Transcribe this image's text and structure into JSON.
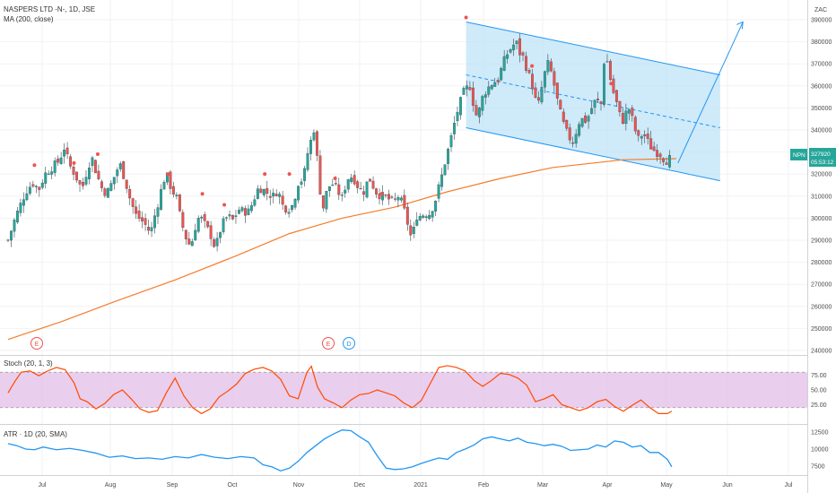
{
  "header": {
    "symbol_line": "NASPERS LTD -N-, 1D, JSE",
    "ma_line": "MA (200, close)",
    "zac_label": "ZAC"
  },
  "price_badge": {
    "ticker": "NPN",
    "price": "327920",
    "countdown": "05:53:12",
    "color": "#26a69a"
  },
  "colors": {
    "up": "#26a69a",
    "down": "#ef5350",
    "ma": "#f57c2b",
    "channel_fill": "#bfe3f7",
    "channel_line": "#2196f3",
    "stoch_band": "#e1bee7",
    "stoch_line": "#ff4a00",
    "atr_line": "#2196f3"
  },
  "events": [
    {
      "label": "E",
      "type": "earnings",
      "date": "2020-06-22"
    },
    {
      "label": "E",
      "type": "earnings",
      "date": "2020-11-23"
    },
    {
      "label": "D",
      "type": "dividend",
      "date": "2020-12-04"
    }
  ],
  "chart_data": [
    {
      "type": "candlestick",
      "title": "NASPERS LTD -N-, 1D, JSE",
      "x_ticks": [
        "Jul",
        "Aug",
        "Sep",
        "Oct",
        "Nov",
        "Dec",
        "2021",
        "Feb",
        "Mar",
        "Apr",
        "May",
        "Jun",
        "Jul"
      ],
      "y_ticks": [
        240000,
        250000,
        260000,
        270000,
        280000,
        290000,
        300000,
        310000,
        320000,
        330000,
        340000,
        350000,
        360000,
        370000,
        380000,
        390000
      ],
      "ylim": [
        236000,
        392000
      ],
      "last_price": 327920,
      "close_path": [
        [
          0,
          290000
        ],
        [
          8,
          300000
        ],
        [
          14,
          306000
        ],
        [
          20,
          312000
        ],
        [
          28,
          316000
        ],
        [
          35,
          313000
        ],
        [
          42,
          320000
        ],
        [
          50,
          323000
        ],
        [
          58,
          326000
        ],
        [
          64,
          332000
        ],
        [
          70,
          324000
        ],
        [
          76,
          320000
        ],
        [
          84,
          313000
        ],
        [
          90,
          322000
        ],
        [
          95,
          328000
        ],
        [
          100,
          321000
        ],
        [
          106,
          314000
        ],
        [
          112,
          311000
        ],
        [
          118,
          316000
        ],
        [
          124,
          322000
        ],
        [
          128,
          324000
        ],
        [
          134,
          316000
        ],
        [
          140,
          307000
        ],
        [
          146,
          301000
        ],
        [
          152,
          299000
        ],
        [
          158,
          296000
        ],
        [
          162,
          293000
        ],
        [
          168,
          303000
        ],
        [
          172,
          309000
        ],
        [
          176,
          316000
        ],
        [
          180,
          320000
        ],
        [
          186,
          313000
        ],
        [
          192,
          309000
        ],
        [
          196,
          300000
        ],
        [
          200,
          294000
        ],
        [
          205,
          288000
        ],
        [
          210,
          290000
        ],
        [
          214,
          298000
        ],
        [
          218,
          301000
        ],
        [
          224,
          297000
        ],
        [
          230,
          293000
        ],
        [
          236,
          286000
        ],
        [
          240,
          293000
        ],
        [
          245,
          298000
        ],
        [
          250,
          301000
        ],
        [
          256,
          299000
        ],
        [
          262,
          304000
        ],
        [
          268,
          303000
        ],
        [
          274,
          303000
        ],
        [
          280,
          309000
        ],
        [
          285,
          314000
        ],
        [
          290,
          313000
        ],
        [
          296,
          311000
        ],
        [
          302,
          310000
        ],
        [
          307,
          313000
        ],
        [
          312,
          306000
        ],
        [
          318,
          304000
        ],
        [
          324,
          306000
        ],
        [
          330,
          316000
        ],
        [
          336,
          318000
        ],
        [
          341,
          330000
        ],
        [
          345,
          336000
        ],
        [
          349,
          342000
        ],
        [
          353,
          318000
        ],
        [
          358,
          304000
        ],
        [
          363,
          313000
        ],
        [
          368,
          316000
        ],
        [
          374,
          313000
        ],
        [
          380,
          309000
        ],
        [
          386,
          318000
        ],
        [
          392,
          319000
        ],
        [
          396,
          316000
        ],
        [
          400,
          313000
        ],
        [
          406,
          312000
        ],
        [
          410,
          319000
        ],
        [
          416,
          314000
        ],
        [
          420,
          311000
        ],
        [
          426,
          310000
        ],
        [
          432,
          309000
        ],
        [
          438,
          307000
        ],
        [
          444,
          310000
        ],
        [
          449,
          306000
        ],
        [
          453,
          300000
        ],
        [
          458,
          292000
        ],
        [
          462,
          295000
        ],
        [
          466,
          303000
        ],
        [
          470,
          300000
        ],
        [
          474,
          303000
        ],
        [
          478,
          301000
        ],
        [
          482,
          304000
        ],
        [
          486,
          308000
        ],
        [
          490,
          314000
        ],
        [
          494,
          320000
        ],
        [
          498,
          327000
        ],
        [
          502,
          333000
        ],
        [
          506,
          340000
        ],
        [
          510,
          347000
        ],
        [
          514,
          352000
        ],
        [
          518,
          357000
        ],
        [
          522,
          359000
        ],
        [
          526,
          360000
        ],
        [
          530,
          350000
        ],
        [
          534,
          345000
        ],
        [
          538,
          353000
        ],
        [
          542,
          357000
        ],
        [
          546,
          359000
        ],
        [
          550,
          361000
        ],
        [
          554,
          362000
        ],
        [
          558,
          363000
        ],
        [
          562,
          369000
        ],
        [
          566,
          373000
        ],
        [
          570,
          376000
        ],
        [
          574,
          378000
        ],
        [
          578,
          380000
        ],
        [
          582,
          375000
        ],
        [
          586,
          373000
        ],
        [
          590,
          368000
        ],
        [
          594,
          363000
        ],
        [
          598,
          358000
        ],
        [
          602,
          349000
        ],
        [
          606,
          357000
        ],
        [
          610,
          365000
        ],
        [
          614,
          370000
        ],
        [
          618,
          366000
        ],
        [
          622,
          359000
        ],
        [
          626,
          351000
        ],
        [
          630,
          345000
        ],
        [
          634,
          340000
        ],
        [
          638,
          337000
        ],
        [
          642,
          334000
        ],
        [
          646,
          339000
        ],
        [
          650,
          344000
        ],
        [
          654,
          345000
        ],
        [
          658,
          344000
        ],
        [
          662,
          348000
        ],
        [
          666,
          352000
        ],
        [
          670,
          354000
        ],
        [
          674,
          349000
        ],
        [
          678,
          371000
        ],
        [
          682,
          371000
        ],
        [
          686,
          361000
        ],
        [
          690,
          355000
        ],
        [
          694,
          350000
        ],
        [
          698,
          343000
        ],
        [
          702,
          347000
        ],
        [
          706,
          350000
        ],
        [
          710,
          345000
        ],
        [
          714,
          339000
        ],
        [
          718,
          335000
        ],
        [
          722,
          339000
        ],
        [
          726,
          336000
        ],
        [
          730,
          333000
        ],
        [
          734,
          331000
        ],
        [
          738,
          330000
        ],
        [
          742,
          329000
        ],
        [
          746,
          327000
        ],
        [
          750,
          326000
        ],
        [
          755,
          327920
        ]
      ],
      "ma200": [
        [
          0,
          245000
        ],
        [
          60,
          253000
        ],
        [
          120,
          262000
        ],
        [
          190,
          272000
        ],
        [
          260,
          283000
        ],
        [
          320,
          293000
        ],
        [
          380,
          300000
        ],
        [
          440,
          305000
        ],
        [
          500,
          312000
        ],
        [
          560,
          318000
        ],
        [
          620,
          323000
        ],
        [
          700,
          326500
        ],
        [
          760,
          327000
        ]
      ],
      "channel": {
        "upper": [
          [
            521,
            389000
          ],
          [
            810,
            365000
          ]
        ],
        "lower": [
          [
            521,
            341000
          ],
          [
            810,
            317000
          ]
        ],
        "mid": [
          [
            521,
            365000
          ],
          [
            810,
            341000
          ]
        ]
      },
      "projection_arrow": [
        [
          762,
          325000
        ],
        [
          836,
          389000
        ]
      ],
      "markers": [
        {
          "x": 30,
          "v": 322000
        },
        {
          "x": 75,
          "v": 323000
        },
        {
          "x": 102,
          "v": 327000
        },
        {
          "x": 182,
          "v": 318000
        },
        {
          "x": 221,
          "v": 309000
        },
        {
          "x": 246,
          "v": 304000
        },
        {
          "x": 292,
          "v": 318000
        },
        {
          "x": 320,
          "v": 318000
        },
        {
          "x": 372,
          "v": 316000
        },
        {
          "x": 425,
          "v": 309000
        },
        {
          "x": 521,
          "v": 389000
        },
        {
          "x": 596,
          "v": 367000
        },
        {
          "x": 686,
          "v": 359000
        }
      ]
    },
    {
      "type": "line",
      "title": "Stoch (20, 1, 3)",
      "y_ticks": [
        25.0,
        50.0,
        75.0
      ],
      "ylim": [
        0,
        100
      ],
      "band": [
        20,
        80
      ],
      "x": [
        0,
        8,
        15,
        25,
        35,
        45,
        55,
        65,
        75,
        82,
        90,
        100,
        110,
        120,
        130,
        140,
        150,
        160,
        170,
        180,
        190,
        200,
        210,
        220,
        230,
        240,
        250,
        260,
        270,
        280,
        290,
        300,
        310,
        320,
        330,
        340,
        345,
        352,
        360,
        370,
        380,
        390,
        400,
        410,
        420,
        430,
        440,
        450,
        460,
        470,
        480,
        490,
        500,
        510,
        520,
        530,
        540,
        550,
        560,
        570,
        580,
        590,
        600,
        610,
        620,
        630,
        640,
        650,
        660,
        670,
        680,
        690,
        700,
        710,
        720,
        730,
        740,
        750,
        755
      ],
      "y": [
        45,
        65,
        80,
        82,
        74,
        82,
        88,
        84,
        62,
        35,
        30,
        18,
        27,
        42,
        50,
        35,
        18,
        12,
        15,
        45,
        70,
        40,
        20,
        10,
        18,
        38,
        48,
        60,
        78,
        85,
        88,
        82,
        68,
        40,
        35,
        80,
        90,
        55,
        35,
        28,
        20,
        33,
        42,
        44,
        50,
        45,
        40,
        28,
        20,
        32,
        60,
        88,
        91,
        88,
        82,
        66,
        56,
        66,
        78,
        76,
        70,
        58,
        30,
        35,
        42,
        25,
        20,
        15,
        20,
        30,
        34,
        22,
        14,
        24,
        33,
        20,
        10,
        10,
        14
      ]
    },
    {
      "type": "line",
      "title": "ATR · 1D (20, SMA)",
      "y_ticks": [
        7500,
        10000,
        12500
      ],
      "ylim": [
        6000,
        13000
      ],
      "x": [
        0,
        10,
        20,
        30,
        40,
        55,
        70,
        85,
        100,
        115,
        130,
        145,
        160,
        175,
        190,
        205,
        220,
        235,
        250,
        265,
        280,
        290,
        300,
        310,
        320,
        330,
        340,
        350,
        360,
        370,
        380,
        390,
        400,
        410,
        420,
        430,
        440,
        450,
        460,
        470,
        480,
        490,
        500,
        510,
        520,
        530,
        540,
        550,
        560,
        570,
        580,
        590,
        600,
        610,
        620,
        630,
        640,
        650,
        660,
        670,
        680,
        690,
        700,
        710,
        720,
        730,
        740,
        750,
        755
      ],
      "y": [
        10800,
        10500,
        10000,
        9900,
        10300,
        9900,
        10100,
        9800,
        9400,
        8800,
        9000,
        8600,
        8700,
        8500,
        8900,
        8700,
        9200,
        8800,
        8600,
        8900,
        8700,
        7700,
        7400,
        6800,
        7200,
        8200,
        9500,
        10500,
        11500,
        12200,
        12800,
        12700,
        11800,
        11000,
        9000,
        7200,
        7000,
        7100,
        7400,
        7900,
        8300,
        8700,
        8500,
        9500,
        10000,
        10600,
        11500,
        11800,
        11500,
        11200,
        11600,
        11000,
        10800,
        10500,
        10700,
        10400,
        9800,
        9900,
        10000,
        10600,
        10300,
        11200,
        11000,
        10300,
        10500,
        9500,
        9500,
        8500,
        7400
      ]
    }
  ]
}
